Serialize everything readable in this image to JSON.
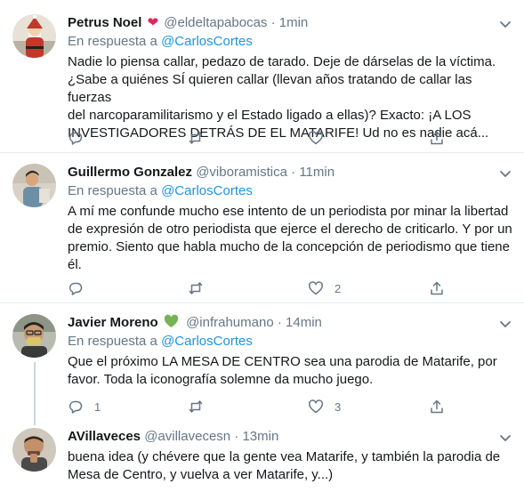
{
  "tweets": [
    {
      "name": "Petrus Noel",
      "handle": "@eldeltapabocas",
      "dot": "·",
      "time": "1min",
      "reply_prefix": "En respuesta a",
      "reply_to": "@CarlosCortes",
      "lines": [
        "Nadie lo piensa callar, pedazo de tarado. Deje de dárselas de la víctima.",
        "¿Sabe a quiénes SÍ quieren callar (llevan años tratando de callar las fuerzas",
        "del narcoparamilitarismo y el Estado ligado a ellas)? Exacto: ¡A LOS",
        "INVESTIGADORES DETRÁS DE EL MATARIFE! Ud no es nadie acá..."
      ],
      "badge_icon": "red-heart-icon",
      "counts": {
        "reply": "",
        "retweet": "",
        "like": ""
      }
    },
    {
      "name": "Guillermo Gonzalez",
      "handle": "@viboramistica",
      "dot": "·",
      "time": "11min",
      "reply_prefix": "En respuesta a",
      "reply_to": "@CarlosCortes",
      "lines": [
        "A mí me confunde mucho ese intento de un periodista por minar la libertad",
        "de expresión de otro periodista que ejerce el derecho de criticarlo. Y por un",
        "premio. Siento que habla mucho de la concepción de periodismo que tiene",
        "él."
      ],
      "counts": {
        "reply": "",
        "retweet": "",
        "like": "2"
      }
    },
    {
      "name": "Javier Moreno",
      "handle": "@infrahumano",
      "dot": "·",
      "time": "14min",
      "reply_prefix": "En respuesta a",
      "reply_to": "@CarlosCortes",
      "lines": [
        "Que el próximo LA MESA DE CENTRO sea una parodia de Matarife, por",
        "favor. Toda la iconografía solemne da mucho juego."
      ],
      "badge_icon": "green-heart-icon",
      "counts": {
        "reply": "1",
        "retweet": "",
        "like": "3"
      }
    },
    {
      "name": "AVillaveces",
      "handle": "@avillavecesn",
      "dot": "·",
      "time": "13min",
      "lines": [
        "buena idea (y chévere que la gente vea Matarife, y también la parodia de",
        "Mesa de Centro, y vuelva a ver Matarife, y...)"
      ]
    }
  ],
  "icons": {
    "reply": "reply-icon",
    "retweet": "retweet-icon",
    "like": "like-icon",
    "share": "share-icon",
    "more": "chevron-down-icon"
  },
  "colors": {
    "link": "#1b95e0",
    "muted": "#657786",
    "text": "#14171a",
    "divider": "#e6ecf0",
    "red_heart": "#e0245e",
    "green_heart": "#77b255"
  }
}
